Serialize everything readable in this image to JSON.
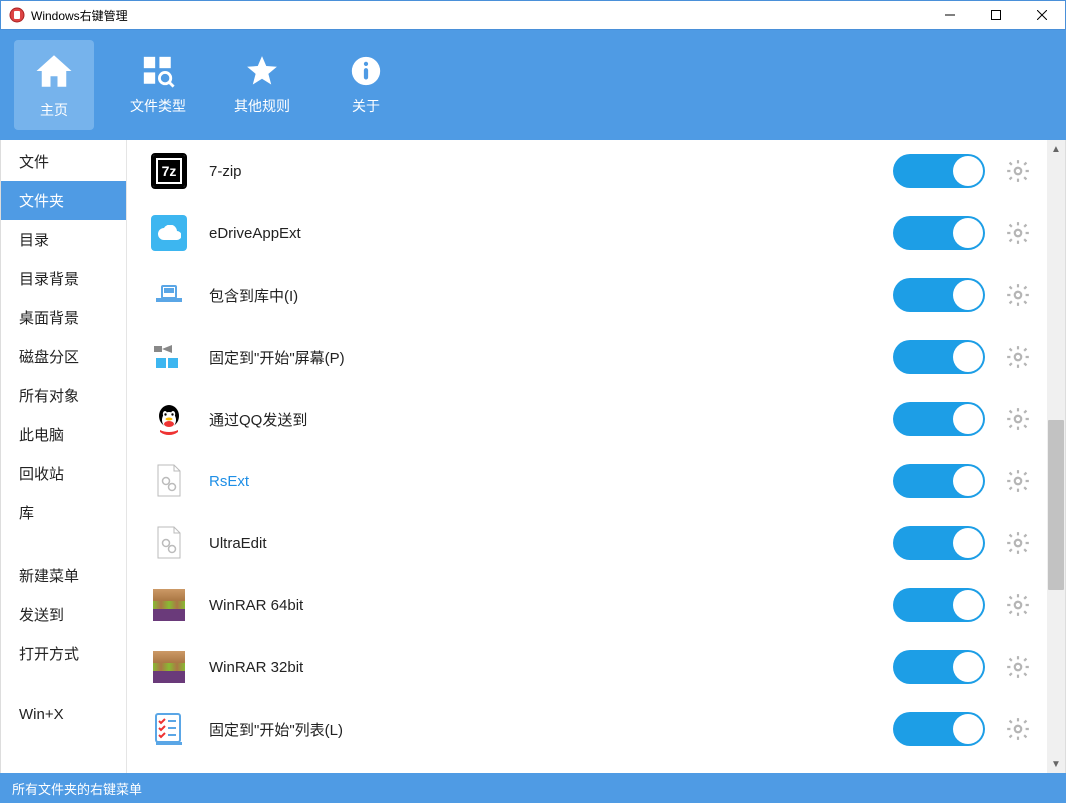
{
  "window": {
    "title": "Windows右键管理"
  },
  "toolbar": {
    "items": [
      {
        "label": "主页",
        "active": true
      },
      {
        "label": "文件类型",
        "active": false
      },
      {
        "label": "其他规则",
        "active": false
      },
      {
        "label": "关于",
        "active": false
      }
    ]
  },
  "sidebar": {
    "group1": [
      "文件",
      "文件夹",
      "目录",
      "目录背景",
      "桌面背景",
      "磁盘分区",
      "所有对象",
      "此电脑",
      "回收站",
      "库"
    ],
    "group2": [
      "新建菜单",
      "发送到",
      "打开方式"
    ],
    "group3": [
      "Win+X"
    ],
    "active_index": 1
  },
  "items": [
    {
      "icon": "7z",
      "label": "7-zip",
      "on": true,
      "blue": false
    },
    {
      "icon": "cloud",
      "label": "eDriveAppExt",
      "on": true,
      "blue": false
    },
    {
      "icon": "lib",
      "label": "包含到库中(I)",
      "on": true,
      "blue": false
    },
    {
      "icon": "tile",
      "label": "固定到\"开始\"屏幕(P)",
      "on": true,
      "blue": false
    },
    {
      "icon": "qq",
      "label": "通过QQ发送到",
      "on": true,
      "blue": false
    },
    {
      "icon": "gen",
      "label": "RsExt",
      "on": true,
      "blue": true
    },
    {
      "icon": "gen",
      "label": "UltraEdit",
      "on": true,
      "blue": false
    },
    {
      "icon": "rar",
      "label": "WinRAR 64bit",
      "on": true,
      "blue": false
    },
    {
      "icon": "rar",
      "label": "WinRAR 32bit",
      "on": true,
      "blue": false
    },
    {
      "icon": "list",
      "label": "固定到\"开始\"列表(L)",
      "on": true,
      "blue": false
    }
  ],
  "status": "所有文件夹的右键菜单"
}
